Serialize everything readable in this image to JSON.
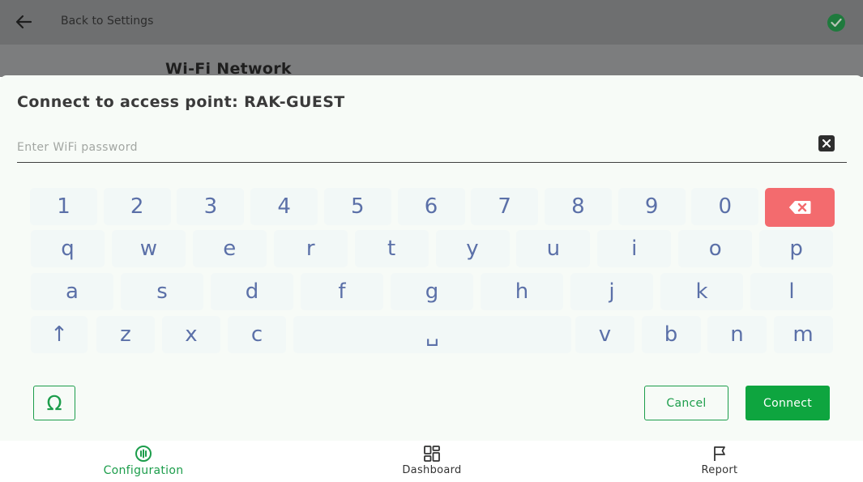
{
  "header": {
    "back_label": "Back to Settings",
    "back_icon": "arrow-left-icon",
    "status_icon": "check-circle-icon"
  },
  "background_page": {
    "title": "Wi-Fi Network"
  },
  "dialog": {
    "title": "Connect to access point: RAK-GUEST",
    "password": {
      "value": "",
      "placeholder": "Enter WiFi password"
    },
    "clear_icon": "clear-x-icon",
    "symbols_label": "Ω",
    "cancel_label": "Cancel",
    "connect_label": "Connect"
  },
  "keyboard": {
    "row1": [
      "1",
      "2",
      "3",
      "4",
      "5",
      "6",
      "7",
      "8",
      "9",
      "0"
    ],
    "row2": [
      "q",
      "w",
      "e",
      "r",
      "t",
      "y",
      "u",
      "i",
      "o",
      "p"
    ],
    "row3": [
      "a",
      "s",
      "d",
      "f",
      "g",
      "h",
      "j",
      "k",
      "l"
    ],
    "row4_left": [
      "↑",
      "z",
      "x",
      "c"
    ],
    "space": "␣",
    "row4_right": [
      "v",
      "b",
      "n",
      "m"
    ],
    "backspace_icon": "backspace-icon"
  },
  "nav": {
    "items": [
      {
        "label": "Configuration",
        "icon": "configuration-icon",
        "active": true
      },
      {
        "label": "Dashboard",
        "icon": "dashboard-icon",
        "active": false
      },
      {
        "label": "Report",
        "icon": "flag-icon",
        "active": false
      }
    ]
  },
  "colors": {
    "accent": "#1c9d4b",
    "connect_bg": "#0ea53f",
    "backspace_bg": "#f36b6e",
    "key_text": "#5b70a8",
    "sheet_bg": "#f7fbf7",
    "overlay": "#6e6f70"
  }
}
